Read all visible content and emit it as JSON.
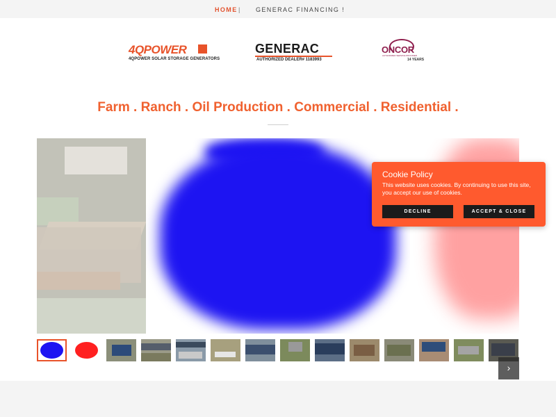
{
  "nav": {
    "home": "HOME",
    "separator": "|",
    "financing": "GENERAC FINANCING !"
  },
  "logos": {
    "fourq": {
      "brand": "4QPOWER",
      "tagline": "4QPOWER SOLAR STORAGE GENERATORS"
    },
    "generac": {
      "brand": "GENERAC",
      "tagline": "AUTHORIZED DEALER# 1183993"
    },
    "oncor": {
      "brand": "ONCOR",
      "tagline": "AUTHORIZED SERVICE PROVIDER",
      "years": "14 YEARS"
    }
  },
  "headline": "Farm . Ranch . Oil Production . Commercial . Residential .",
  "slider": {
    "thumbnail_count": 14,
    "active_index": 0,
    "next_icon": "›"
  },
  "cookie": {
    "title": "Cookie Policy",
    "message": "This website uses cookies. By continuing to use this site, you accept our use of cookies.",
    "decline": "DECLINE",
    "accept": "ACCEPT & CLOSE"
  },
  "colors": {
    "accent": "#e8532a",
    "headline": "#f0612f",
    "cookie_bg": "#ff5a2e",
    "slide_blue": "#1d14f2",
    "slide_red": "#ff2020"
  }
}
